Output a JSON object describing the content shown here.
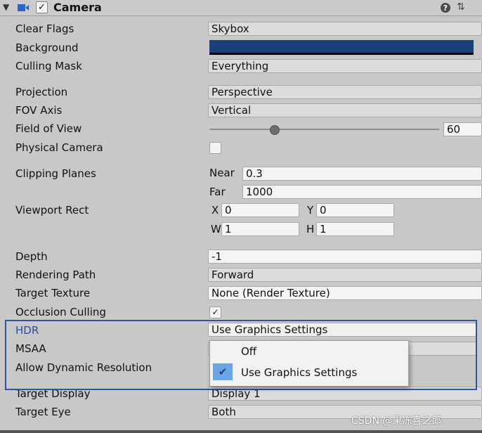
{
  "header": {
    "title": "Camera",
    "enabled_check": "✓",
    "fold_glyph": "▼",
    "settings_glyph": "⇅"
  },
  "labels": {
    "clear_flags": "Clear Flags",
    "background": "Background",
    "culling_mask": "Culling Mask",
    "projection": "Projection",
    "fov_axis": "FOV Axis",
    "field_of_view": "Field of View",
    "physical_camera": "Physical Camera",
    "clipping_planes": "Clipping Planes",
    "viewport_rect": "Viewport Rect",
    "depth": "Depth",
    "rendering_path": "Rendering Path",
    "target_texture": "Target Texture",
    "occlusion_culling": "Occlusion Culling",
    "hdr": "HDR",
    "msaa": "MSAA",
    "allow_dynamic_resolution": "Allow Dynamic Resolution",
    "target_display": "Target Display",
    "target_eye": "Target Eye"
  },
  "values": {
    "clear_flags": "Skybox",
    "background_color": "#1b3f78",
    "culling_mask": "Everything",
    "projection": "Perspective",
    "fov_axis": "Vertical",
    "field_of_view": "60",
    "fov_slider_fraction": 0.28,
    "physical_camera_checked": false,
    "near_label": "Near",
    "near": "0.3",
    "far_label": "Far",
    "far": "1000",
    "x_label": "X",
    "x": "0",
    "y_label": "Y",
    "y": "0",
    "w_label": "W",
    "w": "1",
    "h_label": "H",
    "h": "1",
    "depth": "-1",
    "rendering_path": "Forward",
    "target_texture": "None (Render Texture)",
    "occlusion_culling_check": "✓",
    "hdr": "Use Graphics Settings",
    "target_display": "Display 1",
    "target_eye": "Both"
  },
  "hdr_menu": {
    "items": [
      "Off",
      "Use Graphics Settings"
    ],
    "selected": "Use Graphics Settings",
    "check_glyph": "✔"
  },
  "colors": {
    "highlight_border": "#2c56a0",
    "hdr_label": "#2a4fa2"
  },
  "watermark": "CSDN @果冻喜之郎"
}
